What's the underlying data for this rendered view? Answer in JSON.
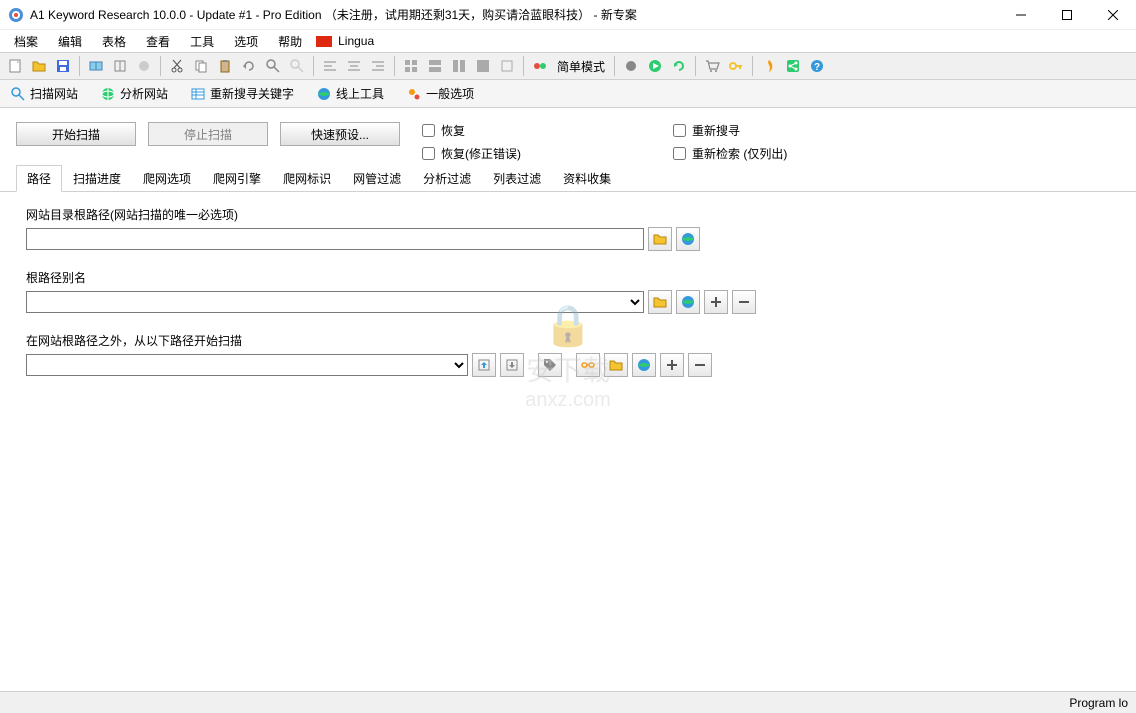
{
  "titlebar": {
    "title": "A1 Keyword Research 10.0.0 - Update #1 - Pro Edition  （未注册，试用期还剩31天，购买请洽蓝眼科技） - 新专案"
  },
  "menu": {
    "file": "档案",
    "edit": "编辑",
    "table": "表格",
    "view": "查看",
    "tools": "工具",
    "options": "选项",
    "help": "帮助",
    "lingua": "Lingua"
  },
  "toolbar": {
    "simple_mode": "简单模式"
  },
  "main_tabs": {
    "scan_site": "扫描网站",
    "analyze_site": "分析网站",
    "research_keywords": "重新搜寻关键字",
    "online_tools": "线上工具",
    "general_options": "一般选项"
  },
  "actions": {
    "start_scan": "开始扫描",
    "stop_scan": "停止扫描",
    "quick_preset": "快速预设..."
  },
  "checkboxes": {
    "resume": "恢复",
    "resume_fix": "恢复(修正错误)",
    "research": "重新搜寻",
    "recheck_list": "重新检索 (仅列出)"
  },
  "sub_tabs": {
    "path": "路径",
    "scan_progress": "扫描进度",
    "crawl_options": "爬网选项",
    "crawl_engine": "爬网引擎",
    "crawl_id": "爬网标识",
    "webmaster_filter": "网管过滤",
    "analysis_filter": "分析过滤",
    "list_filter": "列表过滤",
    "data_collect": "资料收集"
  },
  "form": {
    "root_path_label": "网站目录根路径(网站扫描的唯一必选项)",
    "root_path_value": "",
    "alias_label": "根路径别名",
    "alias_value": "",
    "extra_paths_label": "在网站根路径之外，从以下路径开始扫描",
    "extra_paths_value": ""
  },
  "statusbar": {
    "text": "Program lo"
  },
  "watermark": {
    "text1": "安下载",
    "text2": "anxz.com"
  }
}
